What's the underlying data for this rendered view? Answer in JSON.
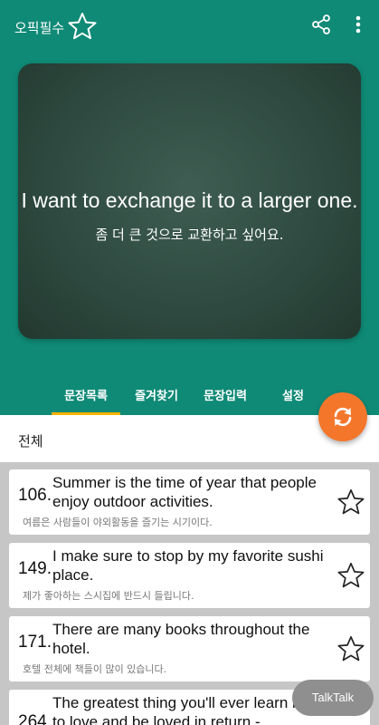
{
  "appbar": {
    "title": "오픽필수",
    "icons": [
      "star-outline-icon",
      "share-icon",
      "more-vert-icon"
    ]
  },
  "board": {
    "english": "I want to exchange it to a larger one.",
    "korean": "좀 더 큰 것으로 교환하고 싶어요."
  },
  "tabs": [
    {
      "label": "문장목록",
      "active": true
    },
    {
      "label": "즐겨찾기",
      "active": false
    },
    {
      "label": "문장입력",
      "active": false
    },
    {
      "label": "설정",
      "active": false
    }
  ],
  "fab": {
    "icon": "refresh-icon"
  },
  "filter": {
    "label": "전체"
  },
  "sentences": [
    {
      "number": "106.",
      "english": "Summer is the time of year that people enjoy outdoor activities.",
      "korean": "여름은 사람들이 야외활동을 즐기는 시기이다."
    },
    {
      "number": "149.",
      "english": "I make sure to stop by my favorite sushi place.",
      "korean": "제가 좋아하는 스시집에 반드시 들립니다."
    },
    {
      "number": "171.",
      "english": "There are many books throughout the hotel.",
      "korean": "호텔 전체에 책들이 많이 있습니다."
    },
    {
      "number": "264.",
      "english": "The greatest thing you'll ever learn is just to love and be loved in return -",
      "korean": ""
    }
  ],
  "talktalk": {
    "label": "TalkTalk"
  },
  "colors": {
    "primary": "#0f8a76",
    "accent": "#f4762b",
    "tab_indicator": "#ffb300"
  }
}
